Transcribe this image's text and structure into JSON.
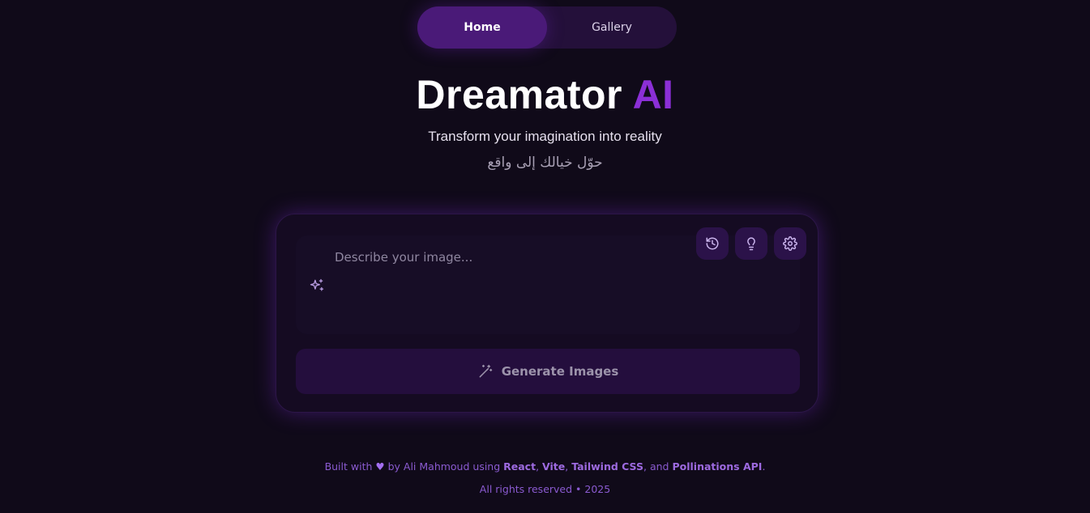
{
  "nav": {
    "tabs": [
      {
        "label": "Home",
        "active": true
      },
      {
        "label": "Gallery",
        "active": false
      }
    ]
  },
  "hero": {
    "title_main": "Dreamator",
    "title_accent": "AI",
    "subtitle": "Transform your imagination into reality",
    "subtitle_ar": "حوّل خيالك إلى واقع"
  },
  "prompt": {
    "placeholder": "Describe your image...",
    "value": "",
    "icons": {
      "sparkle": "sparkles-icon",
      "history": "history-icon",
      "ideas": "lightbulb-icon",
      "settings": "gear-icon"
    }
  },
  "generate": {
    "label": "Generate Images",
    "icon": "magic-wand-icon"
  },
  "footer": {
    "built_with": "Built with",
    "by_text": "by Ali Mahmoud using",
    "tech": [
      "React",
      "Vite",
      "Tailwind CSS",
      "Pollinations API"
    ],
    "and_text": "and",
    "rights": "All rights reserved • 2025"
  },
  "colors": {
    "background": "#100a19",
    "accent": "#8b2fd6",
    "card": "#150b22",
    "active_tab": "#4a1a78"
  }
}
